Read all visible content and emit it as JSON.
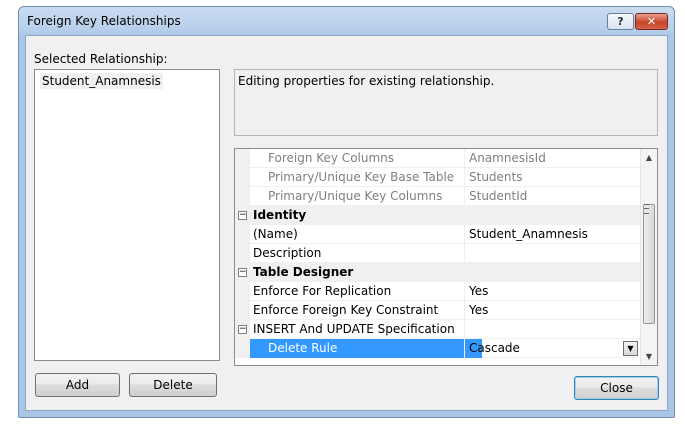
{
  "window": {
    "title": "Foreign Key Relationships",
    "help_label": "?",
    "close_label": "✕"
  },
  "left": {
    "label": "Selected Relationship:",
    "items": [
      "Student_Anamnesis"
    ]
  },
  "buttons": {
    "add": "Add",
    "delete": "Delete",
    "close": "Close"
  },
  "description": "Editing properties for existing relationship.",
  "properties": [
    {
      "name": "Foreign Key Columns",
      "value": "AnamnesisId",
      "kind": "dim"
    },
    {
      "name": "Primary/Unique Key Base Table",
      "value": "Students",
      "kind": "dim"
    },
    {
      "name": "Primary/Unique Key Columns",
      "value": "StudentId",
      "kind": "dim"
    },
    {
      "name": "Identity",
      "value": "",
      "kind": "category"
    },
    {
      "name": "(Name)",
      "value": "Student_Anamnesis",
      "kind": "prop"
    },
    {
      "name": "Description",
      "value": "",
      "kind": "prop"
    },
    {
      "name": "Table Designer",
      "value": "",
      "kind": "category"
    },
    {
      "name": "Enforce For Replication",
      "value": "Yes",
      "kind": "prop"
    },
    {
      "name": "Enforce Foreign Key Constraint",
      "value": "Yes",
      "kind": "prop"
    },
    {
      "name": "INSERT And UPDATE Specification",
      "value": "",
      "kind": "subcategory"
    },
    {
      "name": "Delete Rule",
      "value": "Cascade",
      "kind": "selected"
    }
  ],
  "icons": {
    "expander": "minus-box-icon",
    "dropdown": "dropdown-arrow-icon"
  }
}
